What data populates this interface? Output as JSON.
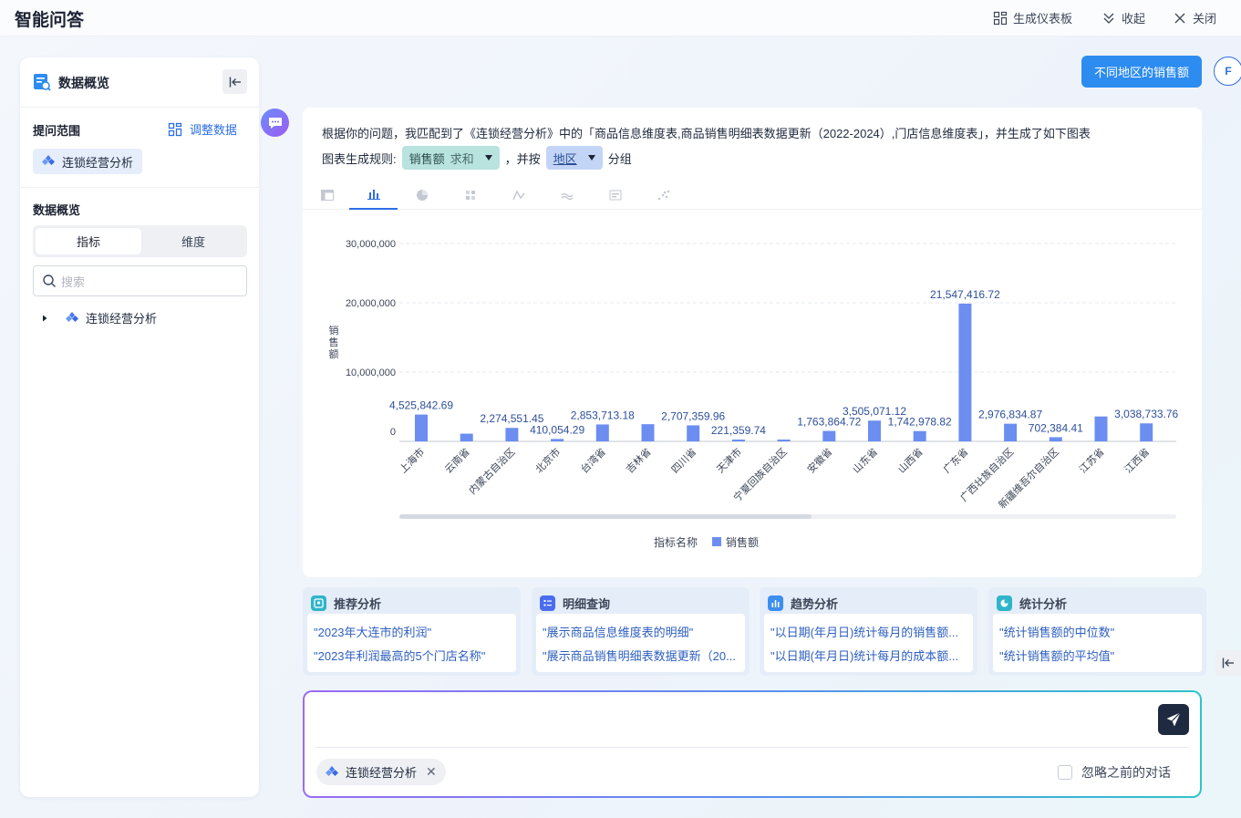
{
  "app": {
    "title": "智能问答"
  },
  "topbar": {
    "dashboard_label": "生成仪表板",
    "collapse_label": "收起",
    "close_label": "关闭"
  },
  "left": {
    "title": "数据概览",
    "scope_label": "提问范围",
    "adjust_label": "调整数据",
    "scope_tag": "连锁经营分析",
    "overview_label": "数据概览",
    "tabs": [
      "指标",
      "维度"
    ],
    "search_placeholder": "搜索",
    "tree_item": "连锁经营分析"
  },
  "question": {
    "text": "不同地区的销售额",
    "avatar": "F"
  },
  "answer": {
    "intro": "根据你的问题，我匹配到了《连锁经营分析》中的「商品信息维度表,商品销售明细表数据更新（2022-2024）,门店信息维度表」，并生成了如下图表",
    "rule_label": "图表生成规则:",
    "measure": "销售额",
    "measure_agg": "求和",
    "and_by": "，并按",
    "dimension": "地区",
    "group_suffix": "分组"
  },
  "chart_icons": [
    "table-icon",
    "bar-chart-icon",
    "pie-chart-icon",
    "heatmap-icon",
    "line-chart-icon",
    "area-chart-icon",
    "kpi-chart-icon",
    "scatter-chart-icon"
  ],
  "colors": {
    "bar": "#6b8ef0",
    "accent": "#2d6fe3",
    "label": "#2d4f9a"
  },
  "chart_data": {
    "type": "bar",
    "ylabel": "销售额",
    "ylim": [
      0,
      30000000
    ],
    "yticks": [
      "0",
      "10,000,000",
      "20,000,000",
      "30,000,000"
    ],
    "legend_title": "指标名称",
    "series": [
      {
        "name": "销售额"
      }
    ],
    "categories": [
      "上海市",
      "云南省",
      "内蒙古自治区",
      "北京市",
      "台湾省",
      "吉林省",
      "四川省",
      "天津市",
      "宁夏回族自治区",
      "安徽省",
      "山东省",
      "山西省",
      "广东省",
      "广西壮族自治区",
      "新疆维吾尔自治区",
      "江苏省",
      "江西省"
    ],
    "values": [
      4525842.69,
      1300000,
      2274551.45,
      410054.29,
      2853713.18,
      2900000,
      2707359.96,
      221359.74,
      300000,
      1763864.72,
      3505071.12,
      1742978.82,
      21547416.72,
      2976834.87,
      702384.41,
      4200000,
      3038733.76
    ],
    "labels": [
      "4,525,842.69",
      "",
      "2,274,551.45",
      "410,054.29",
      "2,853,713.18",
      "",
      "2,707,359.96",
      "221,359.74",
      "",
      "1,763,864.72",
      "3,505,071.12",
      "1,742,978.82",
      "21,547,416.72",
      "2,976,834.87",
      "702,384.41",
      "",
      "3,038,733.76"
    ]
  },
  "suggestions": [
    {
      "title": "推荐分析",
      "icon": "recommend-icon",
      "items": [
        "\"2023年大连市的利润\"",
        "\"2023年利润最高的5个门店名称\""
      ]
    },
    {
      "title": "明细查询",
      "icon": "detail-icon",
      "items": [
        "\"展示商品信息维度表的明细\"",
        "\"展示商品销售明细表数据更新（20..."
      ]
    },
    {
      "title": "趋势分析",
      "icon": "trend-icon",
      "items": [
        "\"以日期(年月日)统计每月的销售额...",
        "\"以日期(年月日)统计每月的成本额..."
      ]
    },
    {
      "title": "统计分析",
      "icon": "stats-icon",
      "items": [
        "\"统计销售额的中位数\"",
        "\"统计销售额的平均值\""
      ]
    }
  ],
  "input": {
    "tag": "连锁经营分析",
    "ignore_label": "忽略之前的对话"
  }
}
